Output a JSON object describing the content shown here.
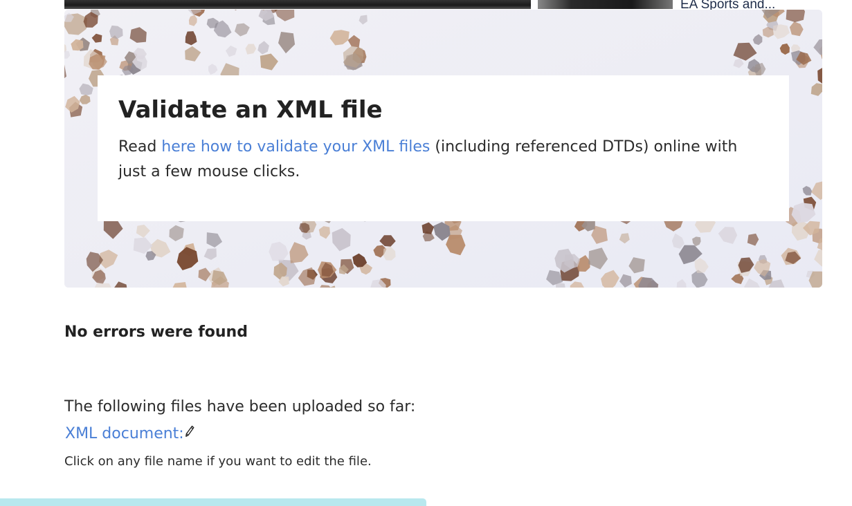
{
  "top": {
    "teaser_text": "EA Sports and..."
  },
  "hero": {
    "title": "Validate an XML file",
    "text_before_link": "Read ",
    "link_text": "here how to validate your XML files",
    "text_after_link": " (including referenced DTDs) online with just a few mouse clicks."
  },
  "result": {
    "status": "No errors were found"
  },
  "files": {
    "intro": "The following files have been uploaded so far:",
    "items": [
      {
        "label": "XML document:",
        "icon": "pencil-icon"
      }
    ],
    "hint": "Click on any file name if you want to edit the file."
  },
  "colors": {
    "link": "#4a7fd6",
    "bottom_bar": "#b8e8ee"
  }
}
